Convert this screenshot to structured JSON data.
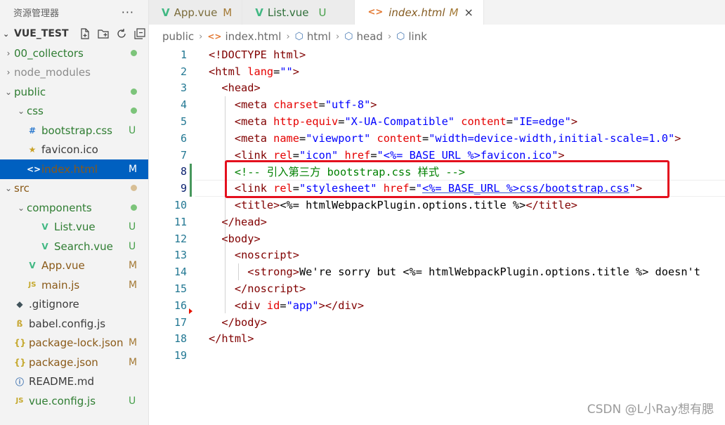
{
  "explorer": {
    "title": "资源管理器",
    "more": "···",
    "project": "VUE_TEST",
    "items": [
      {
        "label": "00_collectors",
        "indent": 0,
        "twisty": "›",
        "icon": "",
        "status": "dot-green",
        "name": "folder-00-collectors"
      },
      {
        "label": "node_modules",
        "indent": 0,
        "twisty": "›",
        "icon": "",
        "status": "",
        "name": "folder-node-modules"
      },
      {
        "label": "public",
        "indent": 0,
        "twisty": "⌄",
        "icon": "",
        "status": "dot-green",
        "name": "folder-public"
      },
      {
        "label": "css",
        "indent": 1,
        "twisty": "⌄",
        "icon": "",
        "status": "dot-green",
        "name": "folder-css"
      },
      {
        "label": "bootstrap.css",
        "indent": 1,
        "twisty": "",
        "icon": "#",
        "status": "U",
        "name": "file-bootstrap-css"
      },
      {
        "label": "favicon.ico",
        "indent": 1,
        "twisty": "",
        "icon": "★",
        "status": "",
        "name": "file-favicon"
      },
      {
        "label": "index.html",
        "indent": 1,
        "twisty": "",
        "icon": "<>",
        "status": "M",
        "name": "file-index-html",
        "selected": true
      },
      {
        "label": "src",
        "indent": 0,
        "twisty": "⌄",
        "icon": "",
        "status": "dot-tan",
        "name": "folder-src"
      },
      {
        "label": "components",
        "indent": 1,
        "twisty": "⌄",
        "icon": "",
        "status": "dot-green",
        "name": "folder-components"
      },
      {
        "label": "List.vue",
        "indent": 2,
        "twisty": "",
        "icon": "V",
        "status": "U",
        "name": "file-list-vue"
      },
      {
        "label": "Search.vue",
        "indent": 2,
        "twisty": "",
        "icon": "V",
        "status": "U",
        "name": "file-search-vue"
      },
      {
        "label": "App.vue",
        "indent": 1,
        "twisty": "",
        "icon": "V",
        "status": "M",
        "name": "file-app-vue"
      },
      {
        "label": "main.js",
        "indent": 1,
        "twisty": "",
        "icon": "JS",
        "status": "M",
        "name": "file-main-js"
      },
      {
        "label": ".gitignore",
        "indent": 0,
        "twisty": "",
        "icon": "◆",
        "status": "",
        "name": "file-gitignore"
      },
      {
        "label": "babel.config.js",
        "indent": 0,
        "twisty": "",
        "icon": "ß",
        "status": "",
        "name": "file-babel-config"
      },
      {
        "label": "package-lock.json",
        "indent": 0,
        "twisty": "",
        "icon": "{}",
        "status": "M",
        "name": "file-package-lock"
      },
      {
        "label": "package.json",
        "indent": 0,
        "twisty": "",
        "icon": "{}",
        "status": "M",
        "name": "file-package-json"
      },
      {
        "label": "README.md",
        "indent": 0,
        "twisty": "",
        "icon": "ⓘ",
        "status": "",
        "name": "file-readme"
      },
      {
        "label": "vue.config.js",
        "indent": 0,
        "twisty": "",
        "icon": "JS",
        "status": "U",
        "name": "file-vue-config"
      }
    ]
  },
  "tabs": [
    {
      "icon": "V",
      "label": "App.vue",
      "status": "M"
    },
    {
      "icon": "V",
      "label": "List.vue",
      "status": "U"
    },
    {
      "icon": "<>",
      "label": "index.html",
      "status": "M",
      "active": true,
      "close": "×"
    }
  ],
  "breadcrumbs": [
    "public",
    "index.html",
    "html",
    "head",
    "link"
  ],
  "editor": {
    "lines": [
      {
        "n": "1",
        "tokens": [
          [
            "punc",
            "<!DOCTYPE "
          ],
          [
            "tag",
            "html"
          ],
          [
            "punc",
            ">"
          ]
        ]
      },
      {
        "n": "2",
        "tokens": [
          [
            "punc",
            "<"
          ],
          [
            "tag",
            "html"
          ],
          [
            "text",
            " "
          ],
          [
            "attr",
            "lang"
          ],
          [
            "text",
            "="
          ],
          [
            "str",
            "\"\""
          ],
          [
            "punc",
            ">"
          ]
        ]
      },
      {
        "n": "3",
        "tokens": [
          [
            "text",
            "  "
          ],
          [
            "punc",
            "<"
          ],
          [
            "tag",
            "head"
          ],
          [
            "punc",
            ">"
          ]
        ]
      },
      {
        "n": "4",
        "tokens": [
          [
            "text",
            "    "
          ],
          [
            "punc",
            "<"
          ],
          [
            "tag",
            "meta"
          ],
          [
            "text",
            " "
          ],
          [
            "attr",
            "charset"
          ],
          [
            "text",
            "="
          ],
          [
            "str",
            "\"utf-8\""
          ],
          [
            "punc",
            ">"
          ]
        ]
      },
      {
        "n": "5",
        "tokens": [
          [
            "text",
            "    "
          ],
          [
            "punc",
            "<"
          ],
          [
            "tag",
            "meta"
          ],
          [
            "text",
            " "
          ],
          [
            "attr",
            "http-equiv"
          ],
          [
            "text",
            "="
          ],
          [
            "str",
            "\"X-UA-Compatible\""
          ],
          [
            "text",
            " "
          ],
          [
            "attr",
            "content"
          ],
          [
            "text",
            "="
          ],
          [
            "str",
            "\"IE=edge\""
          ],
          [
            "punc",
            ">"
          ]
        ]
      },
      {
        "n": "6",
        "tokens": [
          [
            "text",
            "    "
          ],
          [
            "punc",
            "<"
          ],
          [
            "tag",
            "meta"
          ],
          [
            "text",
            " "
          ],
          [
            "attr",
            "name"
          ],
          [
            "text",
            "="
          ],
          [
            "str",
            "\"viewport\""
          ],
          [
            "text",
            " "
          ],
          [
            "attr",
            "content"
          ],
          [
            "text",
            "="
          ],
          [
            "str",
            "\"width=device-width,initial-scale=1.0\""
          ],
          [
            "punc",
            ">"
          ]
        ]
      },
      {
        "n": "7",
        "tokens": [
          [
            "text",
            "    "
          ],
          [
            "punc",
            "<"
          ],
          [
            "tag",
            "link"
          ],
          [
            "text",
            " "
          ],
          [
            "attr",
            "rel"
          ],
          [
            "text",
            "="
          ],
          [
            "str",
            "\"icon\""
          ],
          [
            "text",
            " "
          ],
          [
            "attr",
            "href"
          ],
          [
            "text",
            "="
          ],
          [
            "str",
            "\"<%= BASE_URL %>favicon.ico\""
          ],
          [
            "punc",
            ">"
          ]
        ]
      },
      {
        "n": "8",
        "tokens": [
          [
            "text",
            "    "
          ],
          [
            "cmt",
            "<!-- 引入第三方 bootstrap.css 样式 -->"
          ]
        ]
      },
      {
        "n": "9",
        "tokens": [
          [
            "text",
            "    "
          ],
          [
            "punc",
            "<"
          ],
          [
            "tag",
            "link"
          ],
          [
            "text",
            " "
          ],
          [
            "attr",
            "rel"
          ],
          [
            "text",
            "="
          ],
          [
            "str",
            "\"stylesheet\""
          ],
          [
            "text",
            " "
          ],
          [
            "attr",
            "href"
          ],
          [
            "text",
            "="
          ],
          [
            "str",
            "\""
          ],
          [
            "strul",
            "<%= BASE_URL %>css/bootstrap.css"
          ],
          [
            "str",
            "\""
          ],
          [
            "punc",
            ">"
          ]
        ]
      },
      {
        "n": "10",
        "tokens": [
          [
            "text",
            "    "
          ],
          [
            "punc",
            "<"
          ],
          [
            "tag",
            "title"
          ],
          [
            "punc",
            ">"
          ],
          [
            "text",
            "<%= htmlWebpackPlugin.options.title %>"
          ],
          [
            "punc",
            "</"
          ],
          [
            "tag",
            "title"
          ],
          [
            "punc",
            ">"
          ]
        ]
      },
      {
        "n": "11",
        "tokens": [
          [
            "text",
            "  "
          ],
          [
            "punc",
            "</"
          ],
          [
            "tag",
            "head"
          ],
          [
            "punc",
            ">"
          ]
        ]
      },
      {
        "n": "12",
        "tokens": [
          [
            "text",
            "  "
          ],
          [
            "punc",
            "<"
          ],
          [
            "tag",
            "body"
          ],
          [
            "punc",
            ">"
          ]
        ]
      },
      {
        "n": "13",
        "tokens": [
          [
            "text",
            "    "
          ],
          [
            "punc",
            "<"
          ],
          [
            "tag",
            "noscript"
          ],
          [
            "punc",
            ">"
          ]
        ]
      },
      {
        "n": "14",
        "tokens": [
          [
            "text",
            "      "
          ],
          [
            "punc",
            "<"
          ],
          [
            "tag",
            "strong"
          ],
          [
            "punc",
            ">"
          ],
          [
            "text",
            "We're sorry but <%= htmlWebpackPlugin.options.title %> doesn't"
          ]
        ]
      },
      {
        "n": "15",
        "tokens": [
          [
            "text",
            "    "
          ],
          [
            "punc",
            "</"
          ],
          [
            "tag",
            "noscript"
          ],
          [
            "punc",
            ">"
          ]
        ]
      },
      {
        "n": "16",
        "tokens": [
          [
            "text",
            "    "
          ],
          [
            "punc",
            "<"
          ],
          [
            "tag",
            "div"
          ],
          [
            "text",
            " "
          ],
          [
            "attr",
            "id"
          ],
          [
            "text",
            "="
          ],
          [
            "str",
            "\"app\""
          ],
          [
            "punc",
            "></"
          ],
          [
            "tag",
            "div"
          ],
          [
            "punc",
            ">"
          ]
        ]
      },
      {
        "n": "17",
        "tokens": [
          [
            "text",
            "  "
          ],
          [
            "punc",
            "</"
          ],
          [
            "tag",
            "body"
          ],
          [
            "punc",
            ">"
          ]
        ]
      },
      {
        "n": "18",
        "tokens": [
          [
            "punc",
            "</"
          ],
          [
            "tag",
            "html"
          ],
          [
            "punc",
            ">"
          ]
        ]
      },
      {
        "n": "19",
        "tokens": []
      }
    ]
  },
  "watermark": "CSDN @L小Ray想有腮"
}
